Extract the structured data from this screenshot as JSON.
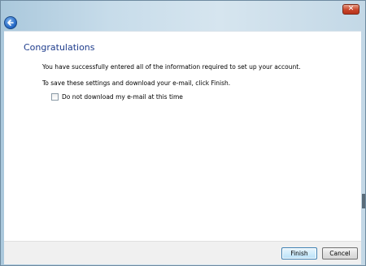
{
  "window": {
    "close_label": "✕"
  },
  "wizard": {
    "heading": "Congratulations",
    "message_success": "You have successfully entered all of the information required to set up your account.",
    "message_instruction": "To save these settings and download your e-mail, click Finish.",
    "checkbox_label": "Do not download my e-mail at this time",
    "checkbox_checked": false
  },
  "footer": {
    "finish_label": "Finish",
    "cancel_label": "Cancel"
  },
  "colors": {
    "heading": "#1e3c8c",
    "accent": "#1f63c2",
    "close": "#c8452a"
  },
  "icons": {
    "back": "back-arrow-icon",
    "close": "close-icon"
  }
}
